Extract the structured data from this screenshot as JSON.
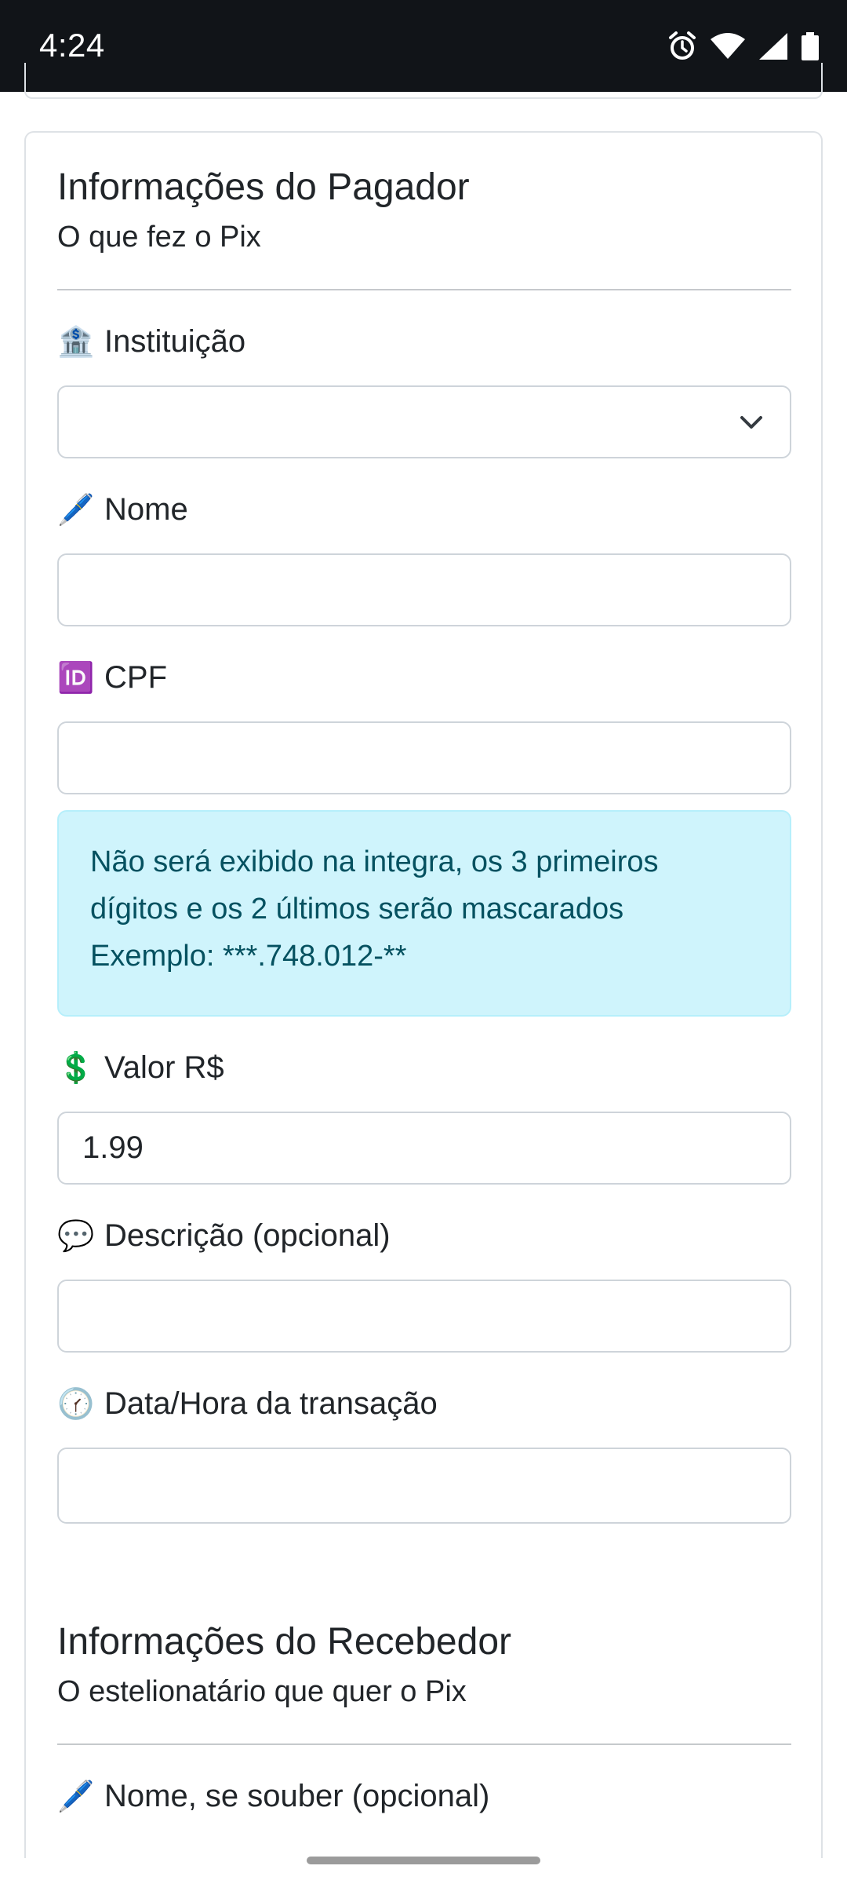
{
  "status_bar": {
    "time": "4:24",
    "icons": [
      "alarm-icon",
      "wifi-icon",
      "cell-signal-icon",
      "battery-icon"
    ]
  },
  "payer": {
    "title": "Informações do Pagador",
    "subtitle": "O que fez o Pix",
    "fields": {
      "institution": {
        "emoji": "🏦",
        "label": "Instituição",
        "value": ""
      },
      "name": {
        "emoji": "🖊️",
        "label": "Nome",
        "value": ""
      },
      "cpf": {
        "emoji": "🆔",
        "label": "CPF",
        "value": ""
      },
      "amount": {
        "emoji": "💲",
        "label": "Valor R$",
        "value": "1.99"
      },
      "description": {
        "emoji": "💬",
        "label": "Descrição (opcional)",
        "value": ""
      },
      "datetime": {
        "emoji": "🕜",
        "label": "Data/Hora da transação",
        "value": ""
      }
    },
    "cpf_notice": {
      "line1": "Não será exibido na integra, os 3 primeiros",
      "line2": "dígitos e os 2 últimos serão mascarados",
      "line3": "Exemplo: ***.748.012-**"
    }
  },
  "receiver": {
    "title": "Informações do Recebedor",
    "subtitle": "O estelionatário que quer o Pix",
    "fields": {
      "name": {
        "emoji": "🖊️",
        "label": "Nome, se souber (opcional)"
      }
    }
  },
  "colors": {
    "status_bar_bg": "#111418",
    "alert_bg": "#cff4fc",
    "alert_text": "#055160",
    "border": "#ced4da"
  }
}
